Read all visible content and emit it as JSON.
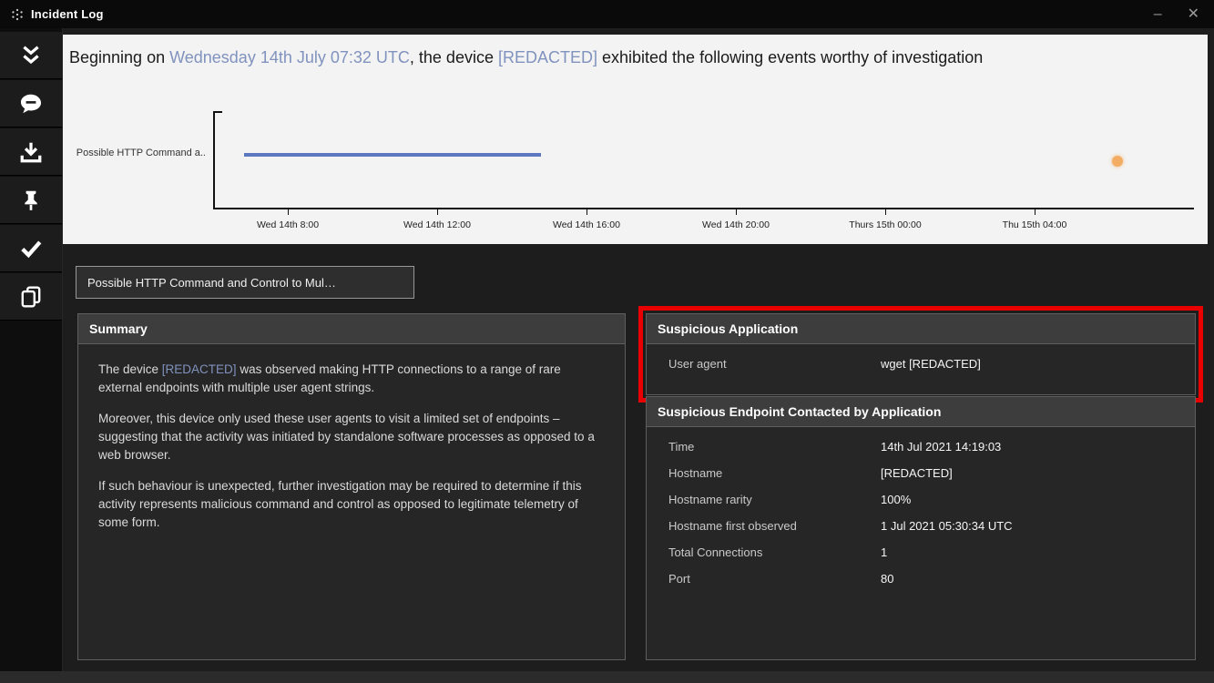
{
  "window": {
    "title": "Incident Log",
    "controls": {
      "minimize": "–",
      "close": "✕"
    }
  },
  "sidebar": {
    "items": [
      {
        "name": "collapse-all",
        "icon": "double-chevron-down-icon"
      },
      {
        "name": "comment",
        "icon": "speech-bubble-icon"
      },
      {
        "name": "download-report",
        "icon": "download-icon"
      },
      {
        "name": "pin-incident",
        "icon": "pin-icon"
      },
      {
        "name": "acknowledge",
        "icon": "check-icon"
      },
      {
        "name": "copy",
        "icon": "copy-icon"
      }
    ]
  },
  "headline": {
    "prefix": "Beginning on ",
    "time": "Wednesday 14th July 07:32 UTC",
    "middle": ", the device ",
    "device": "[REDACTED]",
    "suffix": " exhibited the following events worthy of investigation"
  },
  "chart_data": {
    "type": "timeline",
    "row_label": "Possible HTTP Command a..",
    "x_ticks": [
      "Wed 14th 8:00",
      "Wed 14th 12:00",
      "Wed 14th 16:00",
      "Wed 14th 20:00",
      "Thurs 15th 00:00",
      "Thu 15th 04:00"
    ],
    "events": [
      {
        "kind": "span",
        "row": "Possible HTTP Command a..",
        "start": "Wed 14th ~06:50",
        "end": "Wed 14th ~14:40",
        "color": "#5b77bf"
      },
      {
        "kind": "point",
        "x": "Thu 15th ~06:10",
        "color": "#f3ad62"
      }
    ],
    "x_range": [
      "Wed 14th 07:30",
      "Thu 15th 08:00"
    ],
    "grid": false,
    "legend": "none"
  },
  "tab": {
    "label": "Possible HTTP Command and Control to Mul…"
  },
  "summary": {
    "title": "Summary",
    "p1_prefix": "The device ",
    "p1_device": "[REDACTED]",
    "p1_suffix": " was observed making HTTP connections to a range of rare external endpoints with multiple user agent strings.",
    "p2": "Moreover, this device only used these user agents to visit a limited set of endpoints – suggesting that the activity was initiated by standalone software processes as opposed to a web browser.",
    "p3": "If such behaviour is unexpected, further investigation may be required to determine if this activity represents malicious command and control as opposed to legitimate telemetry of some form."
  },
  "suspicious_application": {
    "title": "Suspicious Application",
    "highlight_color": "#e80000",
    "rows": [
      {
        "label": "User agent",
        "value": "wget [REDACTED]"
      }
    ]
  },
  "suspicious_endpoint": {
    "title": "Suspicious Endpoint Contacted by Application",
    "rows": [
      {
        "label": "Time",
        "value": "14th Jul 2021 14:19:03"
      },
      {
        "label": "Hostname",
        "value": "[REDACTED]"
      },
      {
        "label": "Hostname rarity",
        "value": "100%"
      },
      {
        "label": "Hostname first observed",
        "value": "1 Jul 2021 05:30:34 UTC"
      },
      {
        "label": "Total Connections",
        "value": "1"
      },
      {
        "label": "Port",
        "value": "80"
      }
    ]
  }
}
